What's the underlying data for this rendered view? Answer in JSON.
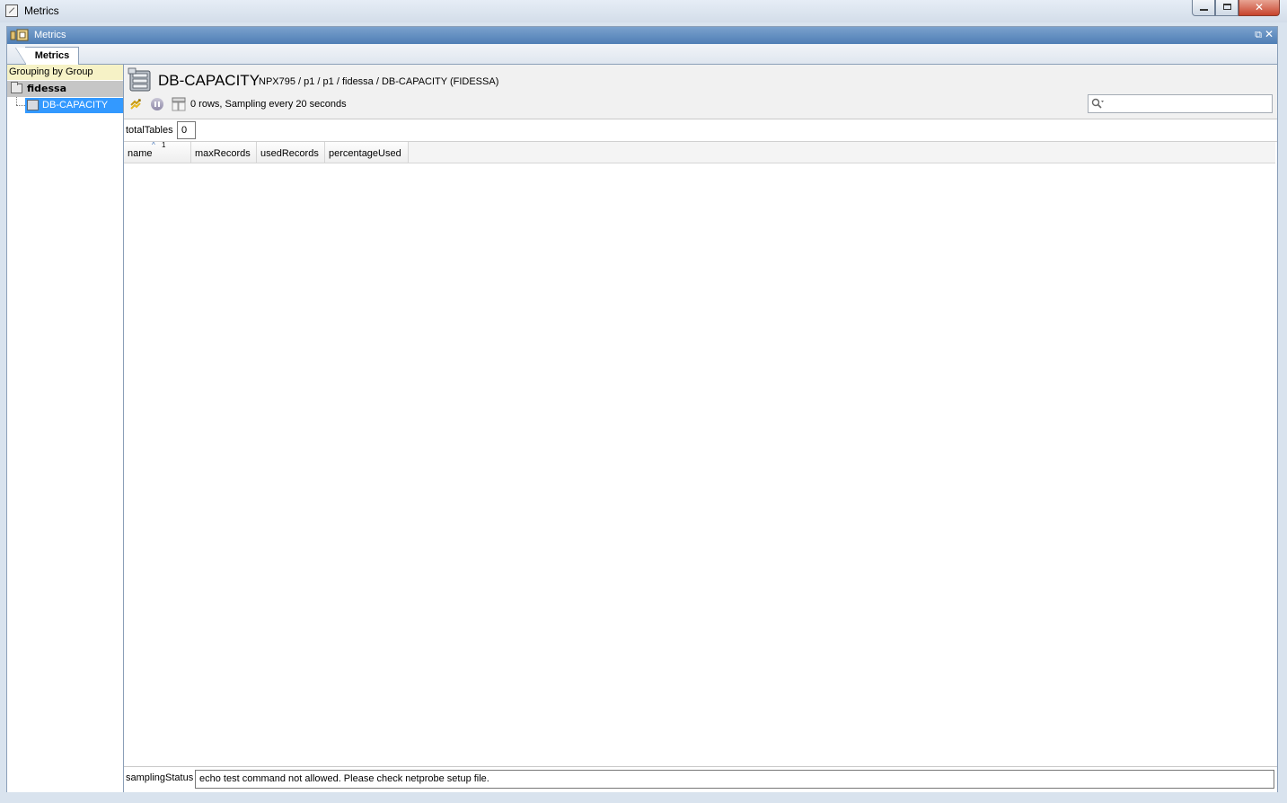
{
  "window": {
    "title": "Metrics",
    "min_icon": "minimize-icon",
    "max_icon": "maximize-icon",
    "close_icon": "close-icon"
  },
  "panel": {
    "title": "Metrics",
    "tab_label": "Metrics"
  },
  "tree": {
    "grouping_label": "Grouping by Group",
    "group_name": "fidessa",
    "item_name": "DB-CAPACITY"
  },
  "dataview": {
    "title": "DB-CAPACITY",
    "path": "NPX795 / p1 / p1 / fidessa / DB-CAPACITY (FIDESSA)",
    "status": "0 rows, Sampling every 20 seconds",
    "search_placeholder": ""
  },
  "headlines": [
    {
      "name": "totalTables",
      "value": "0"
    },
    {
      "name": "samplingStatus",
      "value": "echo test command not allowed. Please check netprobe setup file."
    }
  ],
  "table": {
    "columns": [
      "name",
      "maxRecords",
      "usedRecords",
      "percentageUsed"
    ],
    "sort_order": "1",
    "rows": []
  },
  "colors": {
    "panel_title_bar": "#5b87bd",
    "selection": "#3399ff",
    "grouping_label_bg": "#f6f2c6",
    "group_row_bg": "#c6c6c6"
  }
}
